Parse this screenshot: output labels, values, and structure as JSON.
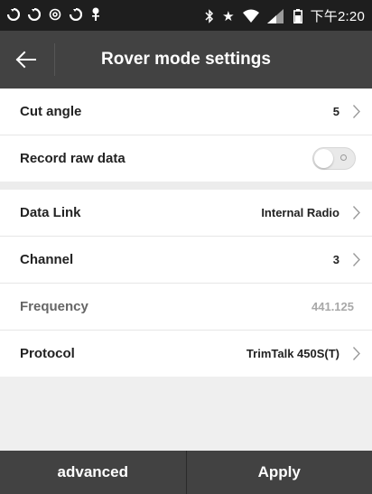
{
  "status_bar": {
    "left_icons": [
      "sync-icon",
      "sync-icon",
      "at-icon",
      "sync-icon",
      "usb-icon"
    ],
    "right_icons": [
      "bluetooth-icon",
      "star-icon",
      "wifi-icon",
      "signal-icon",
      "battery-icon"
    ],
    "time": "下午2:20"
  },
  "header": {
    "back_icon": "arrow-left-icon",
    "title": "Rover mode settings"
  },
  "settings": {
    "cut_angle": {
      "label": "Cut angle",
      "value": "5"
    },
    "record_raw_data": {
      "label": "Record raw data",
      "enabled": false
    },
    "data_link": {
      "label": "Data Link",
      "value": "Internal Radio"
    },
    "channel": {
      "label": "Channel",
      "value": "3"
    },
    "frequency": {
      "label": "Frequency",
      "value": "441.125"
    },
    "protocol": {
      "label": "Protocol",
      "value": "TrimTalk 450S(T)"
    }
  },
  "footer": {
    "advanced_label": "advanced",
    "apply_label": "Apply"
  },
  "colors": {
    "status_bar": "#1e1e1e",
    "title_bar": "#424242",
    "bottom_bar": "#424242",
    "section_gap": "#ececec",
    "disabled_value": "#a8a8a8"
  }
}
